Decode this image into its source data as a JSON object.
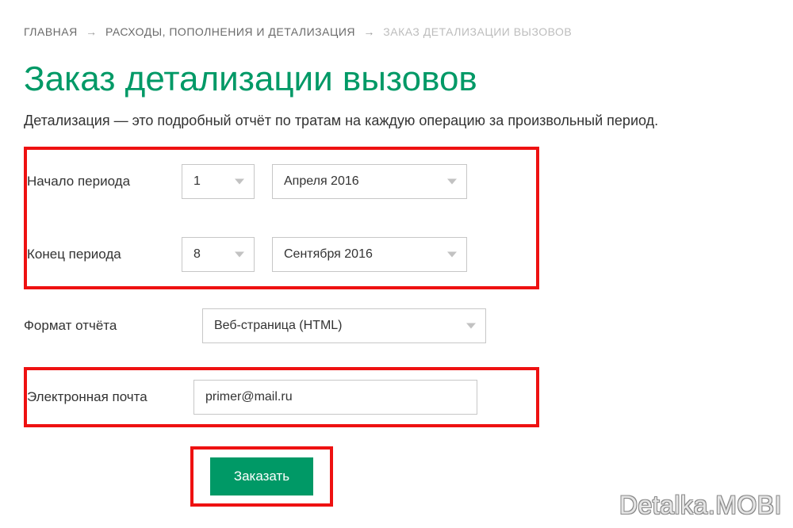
{
  "breadcrumb": {
    "home": "ГЛАВНАЯ",
    "section": "РАСХОДЫ, ПОПОЛНЕНИЯ И ДЕТАЛИЗАЦИЯ",
    "current": "ЗАКАЗ ДЕТАЛИЗАЦИИ ВЫЗОВОВ",
    "separator": "→"
  },
  "title": "Заказ детализации вызовов",
  "intro": "Детализация — это подробный отчёт по тратам на каждую операцию за произвольный период.",
  "form": {
    "start_label": "Начало периода",
    "start_day": "1",
    "start_month": "Апреля 2016",
    "end_label": "Конец периода",
    "end_day": "8",
    "end_month": "Сентября 2016",
    "format_label": "Формат отчёта",
    "format_value": "Веб-страница (HTML)",
    "email_label": "Электронная почта",
    "email_value": "primer@mail.ru",
    "submit_label": "Заказать"
  },
  "watermark": "Detalka.MOBI",
  "colors": {
    "accent": "#009966",
    "highlight_border": "#e11"
  }
}
